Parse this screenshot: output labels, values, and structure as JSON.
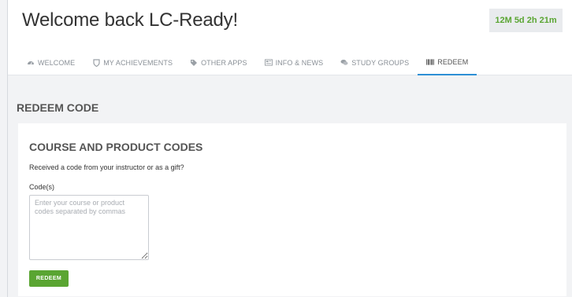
{
  "header": {
    "title": "Welcome back LC-Ready!",
    "timer": "12M 5d 2h 21m"
  },
  "tabs": [
    {
      "label": "WELCOME",
      "icon": "dashboard-icon"
    },
    {
      "label": "MY ACHIEVEMENTS",
      "icon": "shield-icon"
    },
    {
      "label": "OTHER APPS",
      "icon": "tag-icon"
    },
    {
      "label": "INFO & NEWS",
      "icon": "newspaper-icon"
    },
    {
      "label": "STUDY GROUPS",
      "icon": "chat-icon"
    },
    {
      "label": "REDEEM",
      "icon": "barcode-icon",
      "active": true
    }
  ],
  "section": {
    "heading": "REDEEM CODE"
  },
  "card": {
    "title": "COURSE AND PRODUCT CODES",
    "description": "Received a code from your instructor or as a gift?",
    "code_label": "Code(s)",
    "code_placeholder": "Enter your course or product codes separated by commas",
    "code_value": "",
    "redeem_label": "REDEEM"
  },
  "colors": {
    "accent_green": "#5aa532",
    "active_tab_underline": "#2d8fd5",
    "page_background": "#f2f3f5"
  }
}
